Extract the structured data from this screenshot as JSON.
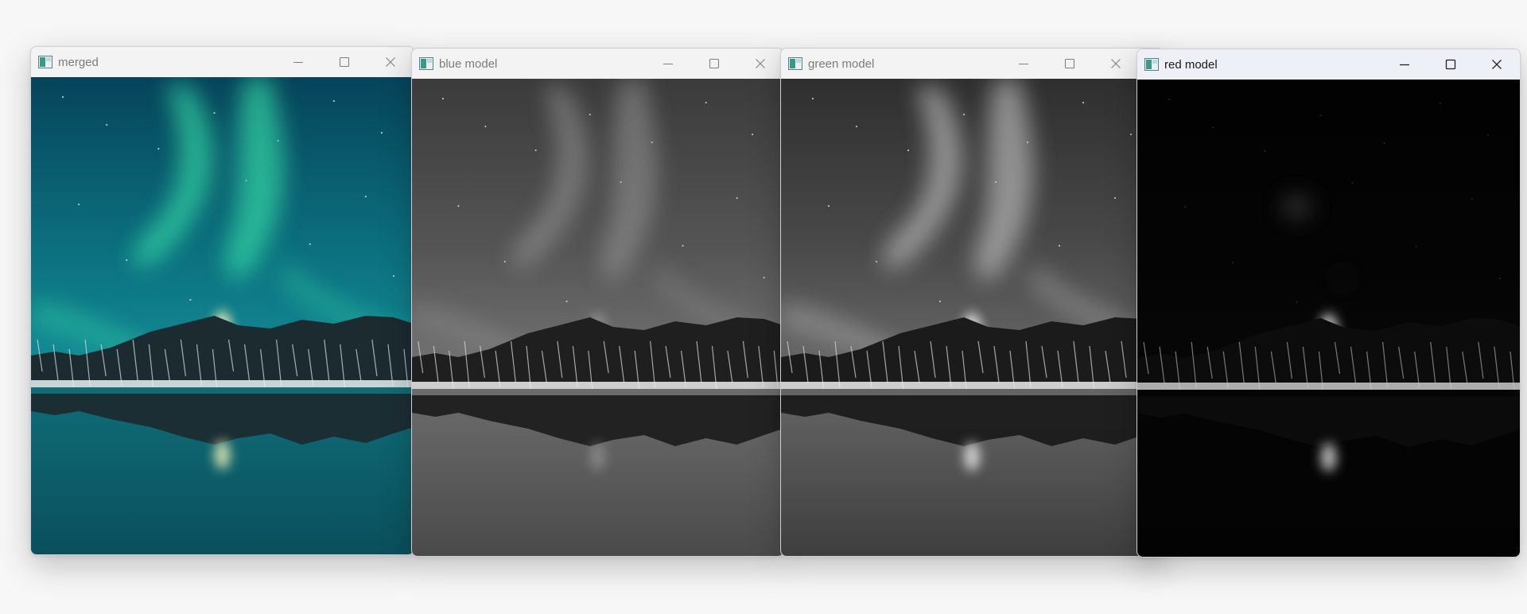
{
  "windows": [
    {
      "title": "merged",
      "mode": "color"
    },
    {
      "title": "blue model",
      "mode": "blue"
    },
    {
      "title": "green model",
      "mode": "green"
    },
    {
      "title": "red model",
      "mode": "red"
    }
  ],
  "icons": {
    "app": "app-window-icon",
    "minimize": "minimize-icon",
    "maximize": "maximize-icon",
    "close": "close-icon"
  },
  "colors": {
    "merged_sky_top": "#06445a",
    "merged_sky_mid": "#0f7f8a",
    "aurora_green": "#37e0a8",
    "aurora_glow": "#f2f4b5",
    "red_channel_bg": "#050505"
  }
}
